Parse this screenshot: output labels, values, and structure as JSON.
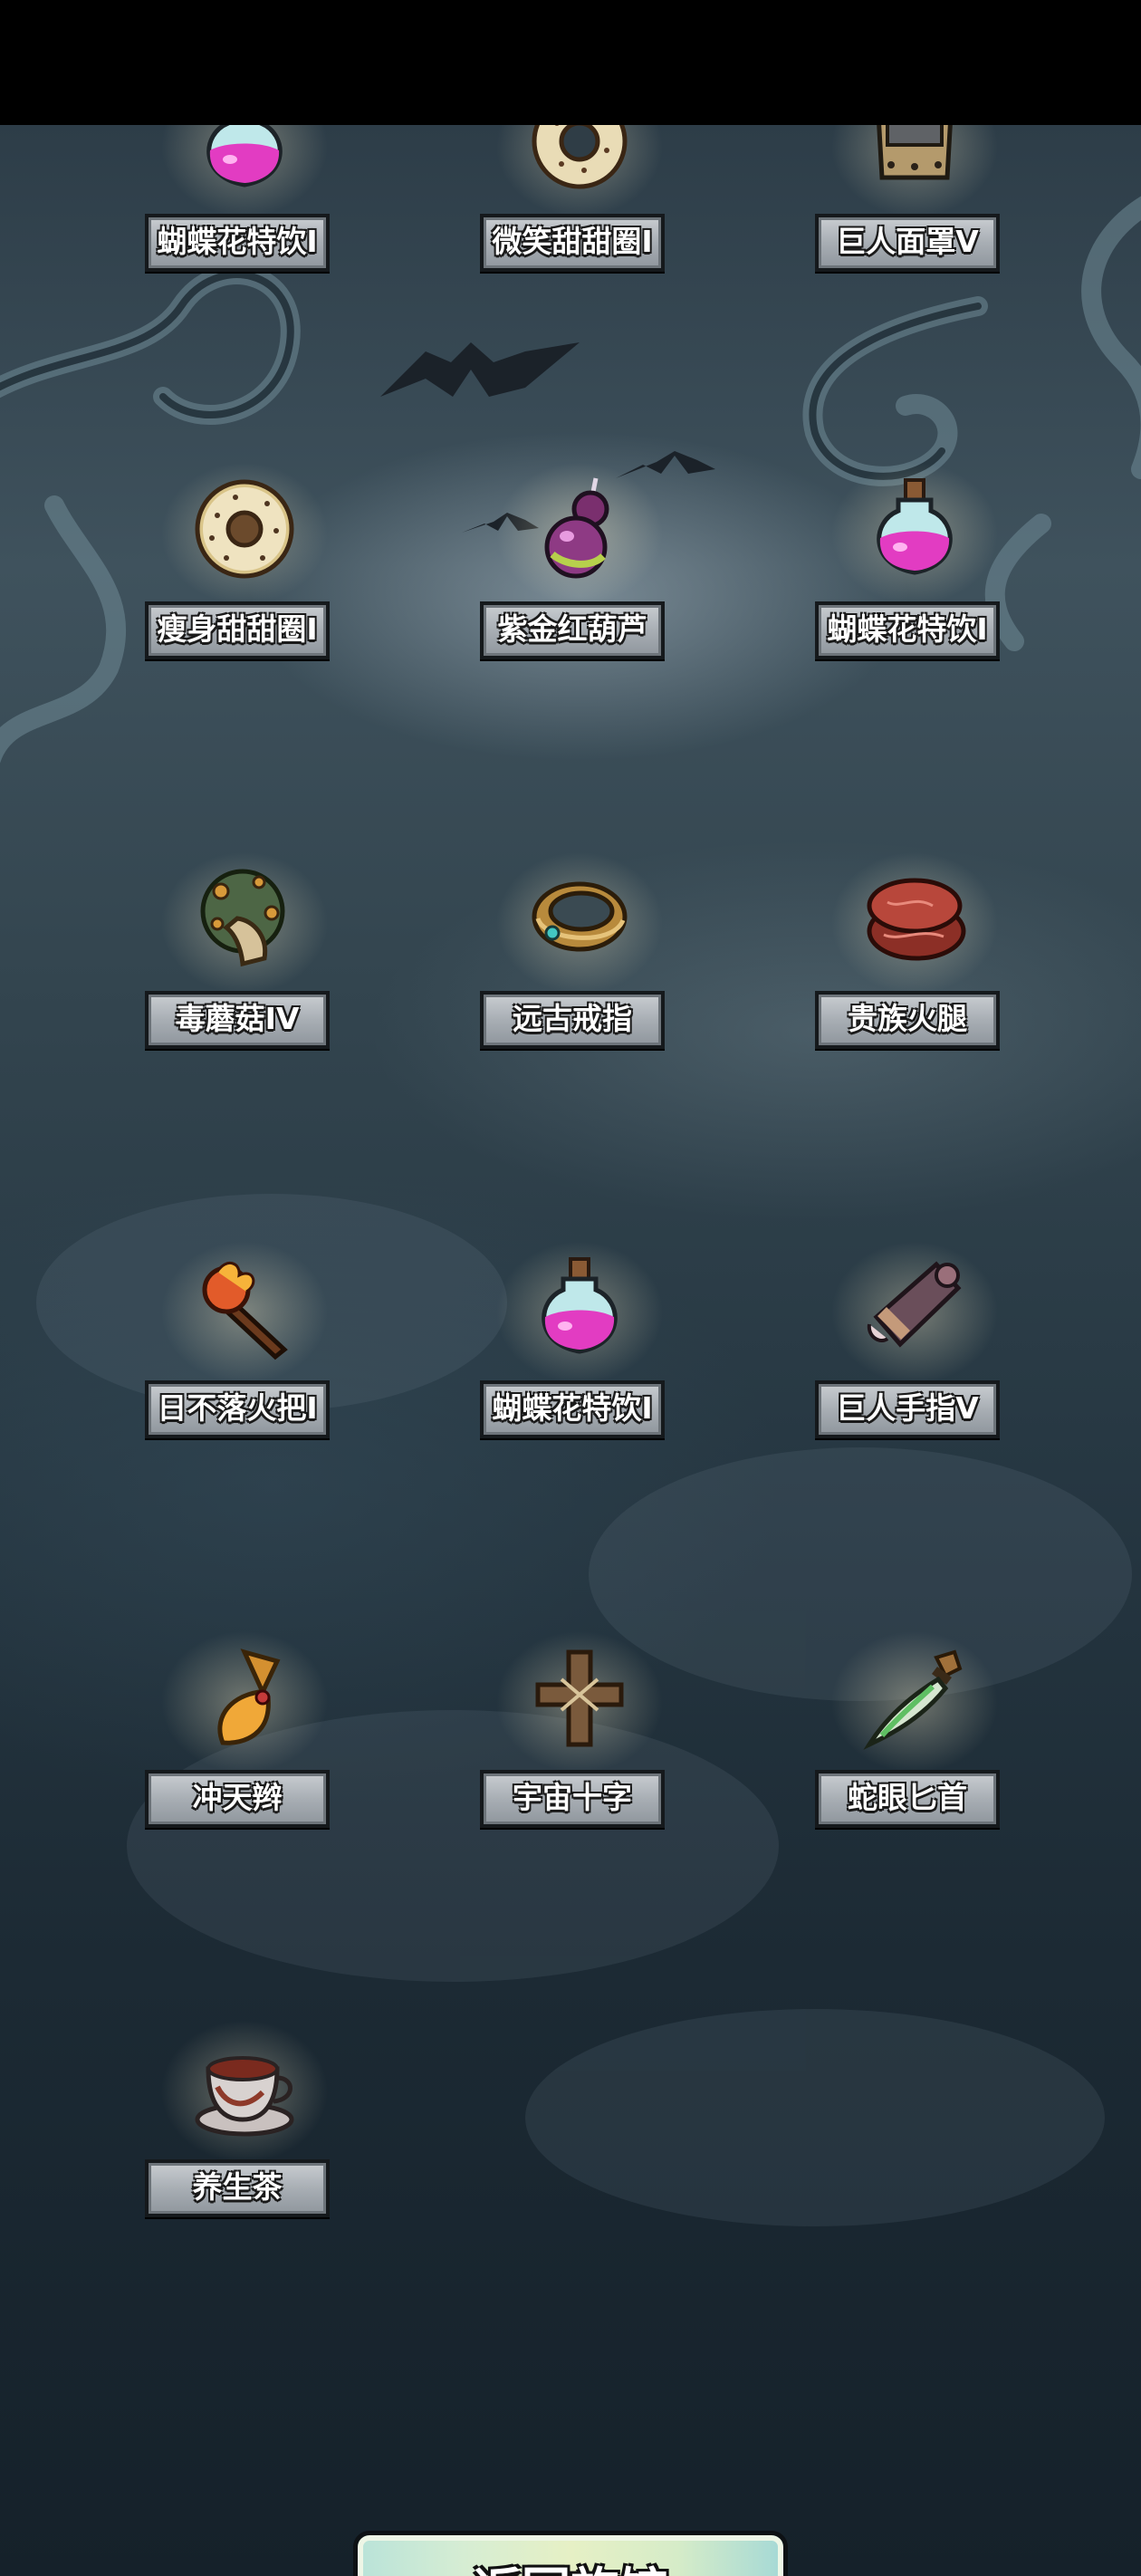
{
  "items": [
    {
      "id": "butterfly-drink",
      "label": "蝴蝶花特饮I",
      "icon": "potion-bottle-icon"
    },
    {
      "id": "smile-donut",
      "label": "微笑甜甜圈I",
      "icon": "donut-icon"
    },
    {
      "id": "giant-mask",
      "label": "巨人面罩V",
      "icon": "giant-mask-icon"
    },
    {
      "id": "slim-donut",
      "label": "瘦身甜甜圈I",
      "icon": "donut-icon"
    },
    {
      "id": "purple-gourd",
      "label": "紫金红葫芦",
      "icon": "gourd-icon"
    },
    {
      "id": "butterfly-drink-2",
      "label": "蝴蝶花特饮I",
      "icon": "potion-bottle-icon"
    },
    {
      "id": "poison-mushroom",
      "label": "毒蘑菇IV",
      "icon": "mushroom-icon"
    },
    {
      "id": "ancient-ring",
      "label": "远古戒指",
      "icon": "ring-icon"
    },
    {
      "id": "noble-ham",
      "label": "贵族火腿",
      "icon": "ham-icon"
    },
    {
      "id": "eternal-torch",
      "label": "日不落火把I",
      "icon": "torch-icon"
    },
    {
      "id": "butterfly-drink-3",
      "label": "蝴蝶花特饮I",
      "icon": "potion-bottle-icon"
    },
    {
      "id": "giant-finger",
      "label": "巨人手指V",
      "icon": "giant-finger-icon"
    },
    {
      "id": "sky-braid",
      "label": "冲天辫",
      "icon": "braid-icon"
    },
    {
      "id": "cosmic-cross",
      "label": "宇宙十字",
      "icon": "cross-icon"
    },
    {
      "id": "snake-eye-dagger",
      "label": "蛇眼匕首",
      "icon": "dagger-icon"
    },
    {
      "id": "health-tea",
      "label": "养生茶",
      "icon": "teacup-icon"
    }
  ],
  "footer": {
    "return_button_label": "返回旅馆"
  },
  "colors": {
    "label_plate": "#a8aeb4",
    "label_border": "#15191c",
    "button_fill": "#e6f0c5",
    "background_top": "#3f525d",
    "background_bottom": "#15212a"
  }
}
